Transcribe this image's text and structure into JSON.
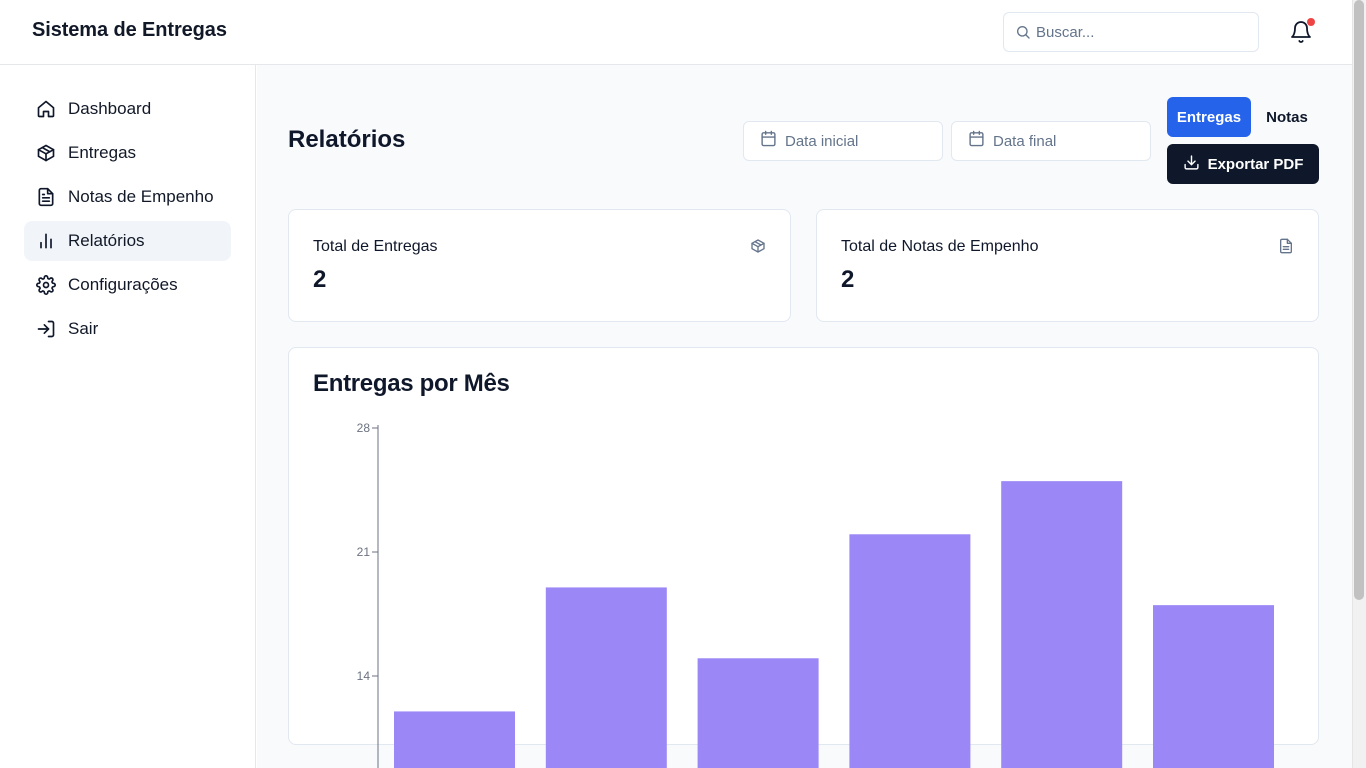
{
  "header": {
    "app_title": "Sistema de Entregas",
    "search_placeholder": "Buscar...",
    "has_notification": true,
    "notification_color": "#ef4444"
  },
  "sidebar": {
    "items": [
      {
        "label": "Dashboard",
        "icon": "home-icon",
        "active": false
      },
      {
        "label": "Entregas",
        "icon": "package-icon",
        "active": false
      },
      {
        "label": "Notas de Empenho",
        "icon": "file-text-icon",
        "active": false
      },
      {
        "label": "Relatórios",
        "icon": "bar-chart-icon",
        "active": true
      },
      {
        "label": "Configurações",
        "icon": "gear-icon",
        "active": false
      },
      {
        "label": "Sair",
        "icon": "log-in-icon",
        "active": false
      }
    ]
  },
  "main": {
    "page_title": "Relatórios",
    "date_start_placeholder": "Data inicial",
    "date_end_placeholder": "Data final",
    "tabs": [
      {
        "label": "Entregas",
        "active": true
      },
      {
        "label": "Notas",
        "active": false
      }
    ],
    "export_label": "Exportar PDF",
    "stats": [
      {
        "label": "Total de Entregas",
        "value": "2",
        "icon": "package-icon"
      },
      {
        "label": "Total de Notas de Empenho",
        "value": "2",
        "icon": "file-text-icon"
      }
    ],
    "chart_title": "Entregas por Mês"
  },
  "colors": {
    "primary": "#2563eb",
    "dark_button": "#0f172a",
    "bar": "#9b87f5",
    "active_nav_bg": "#f1f5f9"
  },
  "chart_data": {
    "type": "bar",
    "title": "Entregas por Mês",
    "categories": [
      "",
      "",
      "",
      "",
      "",
      ""
    ],
    "values": [
      12,
      19,
      15,
      22,
      25,
      18
    ],
    "ylim": [
      0,
      28
    ],
    "yticks": [
      14,
      21,
      28
    ],
    "grid": false,
    "legend": "none"
  }
}
